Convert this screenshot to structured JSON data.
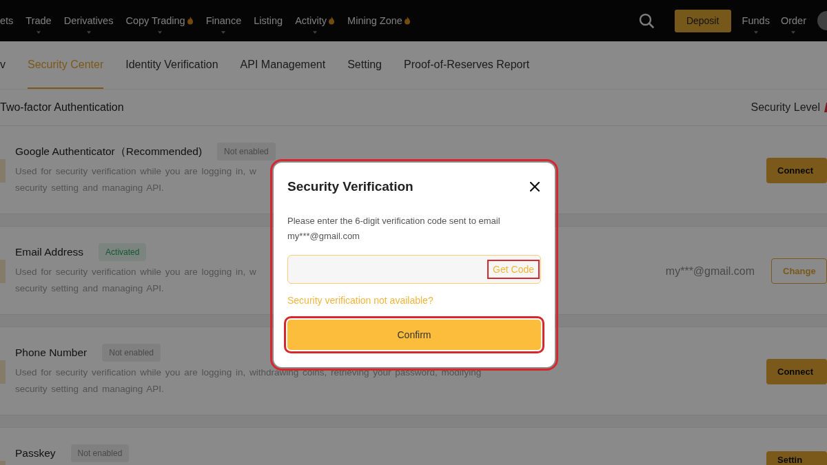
{
  "nav": {
    "items": [
      {
        "label": "ets",
        "flame": false,
        "caret": false
      },
      {
        "label": "Trade",
        "flame": false,
        "caret": true
      },
      {
        "label": "Derivatives",
        "flame": false,
        "caret": true
      },
      {
        "label": "Copy Trading",
        "flame": true,
        "caret": true
      },
      {
        "label": "Finance",
        "flame": false,
        "caret": true
      },
      {
        "label": "Listing",
        "flame": false,
        "caret": false
      },
      {
        "label": "Activity",
        "flame": true,
        "caret": true
      },
      {
        "label": "Mining Zone",
        "flame": true,
        "caret": false
      }
    ],
    "deposit": "Deposit",
    "right_items": [
      {
        "label": "Funds",
        "caret": true
      },
      {
        "label": "Order",
        "caret": true
      }
    ]
  },
  "tabs": [
    {
      "label": "v",
      "selected": false
    },
    {
      "label": "Security Center",
      "selected": true
    },
    {
      "label": "Identity Verification",
      "selected": false
    },
    {
      "label": "API Management",
      "selected": false
    },
    {
      "label": "Setting",
      "selected": false
    },
    {
      "label": "Proof-of-Reserves Report",
      "selected": false
    }
  ],
  "section": {
    "title": "Two-factor Authentication",
    "security_level": "Security Level"
  },
  "rows": [
    {
      "title": "Google Authenticator（Recommended)",
      "status": {
        "label": "Not enabled",
        "kind": "inactive"
      },
      "description": [
        "Used for security verification while you are logging in, w",
        "security setting and managing API."
      ],
      "action": {
        "label": "Connect",
        "kind": "filled"
      }
    },
    {
      "title": "Email Address",
      "status": {
        "label": "Activated",
        "kind": "active"
      },
      "description": [
        "Used for security verification while you are logging in, w",
        "security setting and managing API."
      ],
      "value": "my***@gmail.com",
      "action": {
        "label": "Change",
        "kind": "outline"
      }
    },
    {
      "title": "Phone Number",
      "status": {
        "label": "Not enabled",
        "kind": "inactive"
      },
      "description": [
        "Used for security verification while you are logging in, withdrawing coins, retrieving your password, modifying",
        "security setting and managing API."
      ],
      "action": {
        "label": "Connect",
        "kind": "filled"
      }
    },
    {
      "title": "Passkey",
      "status": {
        "label": "Not enabled",
        "kind": "inactive"
      },
      "description": [],
      "action": {
        "label": "Settin",
        "kind": "filled"
      }
    }
  ],
  "modal": {
    "title": "Security Verification",
    "message": "Please enter the 6-digit verification code sent to email my***@gmail.com",
    "get_code": "Get Code",
    "help_link": "Security verification not available?",
    "confirm": "Confirm"
  }
}
